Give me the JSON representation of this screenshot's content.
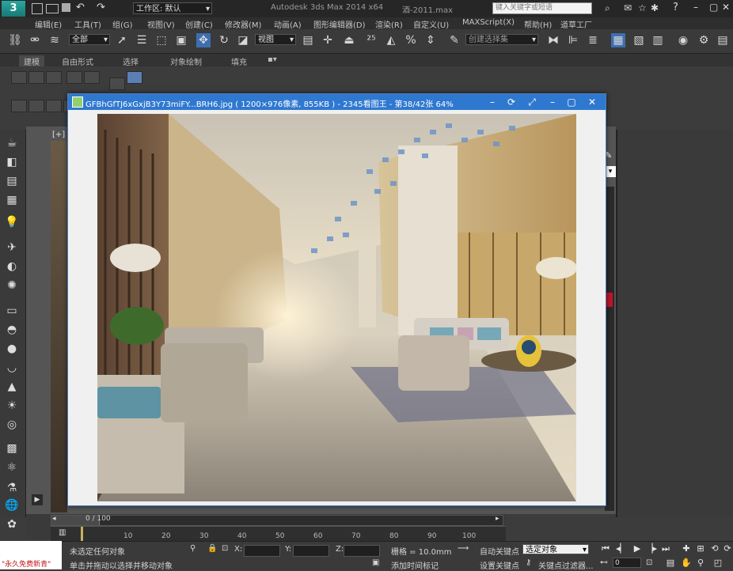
{
  "titlebar": {
    "workspace_label": "工作区: 默认",
    "app_title": "Autodesk 3ds Max  2014 x64",
    "file_name": "酒-2011.max",
    "search_placeholder": "键入关键字或短语"
  },
  "menus": [
    "编辑(E)",
    "工具(T)",
    "组(G)",
    "视图(V)",
    "创建(C)",
    "修改器(M)",
    "动画(A)",
    "图形编辑器(D)",
    "渲染(R)",
    "自定义(U)",
    "MAXScript(X)",
    "帮助(H)",
    "道草工厂"
  ],
  "toolbar": {
    "selection_filter": "全部",
    "reference_coord": "视图",
    "named_selection": "创建选择集"
  },
  "ribbon_tabs": [
    "建模",
    "自由形式",
    "选择",
    "对象绘制",
    "填充"
  ],
  "viewport": {
    "label": "[+]"
  },
  "viewer": {
    "title": "GFBhGfTJ6xGxjB3Y73miFY...BRH6.jpg ( 1200×976像素, 855KB ) - 2345看图王 - 第38/42张 64%"
  },
  "timeline": {
    "slider_label": "0 / 100",
    "ticks": [
      "0",
      "10",
      "20",
      "30",
      "40",
      "50",
      "60",
      "70",
      "80",
      "90",
      "100"
    ]
  },
  "status": {
    "maxscript_text": "\"永久免费新青\"",
    "selection_info": "未选定任何对象",
    "prompt": "单击并拖动以选择并移动对象",
    "x_label": "X:",
    "y_label": "Y:",
    "z_label": "Z:",
    "grid": "栅格 = 10.0mm",
    "auto_key": "自动关键点",
    "set_key": "设置关键点",
    "key_filter_select": "选定对象",
    "key_filters": "关键点过滤器...",
    "add_time_tag": "添加时间标记",
    "frame_value": "0"
  },
  "colors": {
    "viewer_title": "#2f78d0",
    "ui_bg": "#3c3c3c"
  }
}
